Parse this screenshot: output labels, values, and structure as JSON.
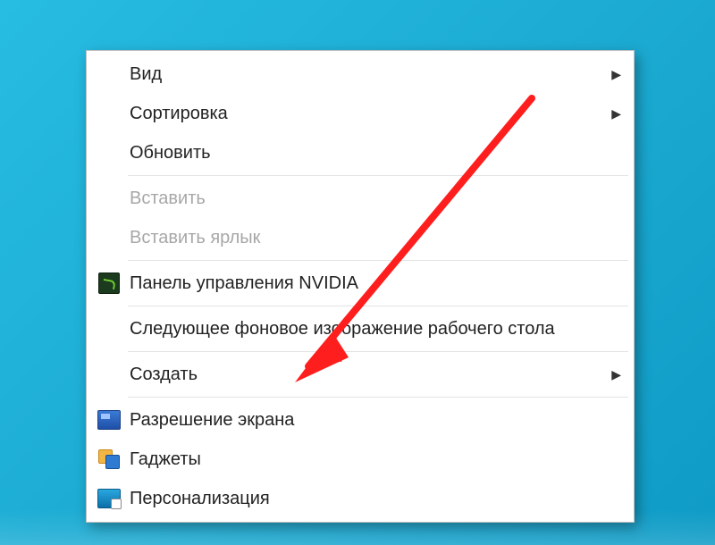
{
  "menu": {
    "items": [
      {
        "id": "view",
        "label": "Вид",
        "submenu": true,
        "enabled": true,
        "icon": null
      },
      {
        "id": "sort",
        "label": "Сортировка",
        "submenu": true,
        "enabled": true,
        "icon": null
      },
      {
        "id": "refresh",
        "label": "Обновить",
        "submenu": false,
        "enabled": true,
        "icon": null
      },
      {
        "sep": true
      },
      {
        "id": "paste",
        "label": "Вставить",
        "submenu": false,
        "enabled": false,
        "icon": null
      },
      {
        "id": "paste-lnk",
        "label": "Вставить ярлык",
        "submenu": false,
        "enabled": false,
        "icon": null
      },
      {
        "sep": true
      },
      {
        "id": "nvidia",
        "label": "Панель управления NVIDIA",
        "submenu": false,
        "enabled": true,
        "icon": "nvidia"
      },
      {
        "sep": true
      },
      {
        "id": "next-bg",
        "label": "Следующее фоновое изображение рабочего стола",
        "submenu": false,
        "enabled": true,
        "icon": null
      },
      {
        "sep": true
      },
      {
        "id": "new",
        "label": "Создать",
        "submenu": true,
        "enabled": true,
        "icon": null
      },
      {
        "sep": true
      },
      {
        "id": "resolution",
        "label": "Разрешение экрана",
        "submenu": false,
        "enabled": true,
        "icon": "resolution"
      },
      {
        "id": "gadgets",
        "label": "Гаджеты",
        "submenu": false,
        "enabled": true,
        "icon": "gadgets"
      },
      {
        "id": "personalize",
        "label": "Персонализация",
        "submenu": false,
        "enabled": true,
        "icon": "personalize"
      }
    ]
  },
  "annotation": {
    "arrow_target": "resolution",
    "color": "#ff1e1e"
  }
}
